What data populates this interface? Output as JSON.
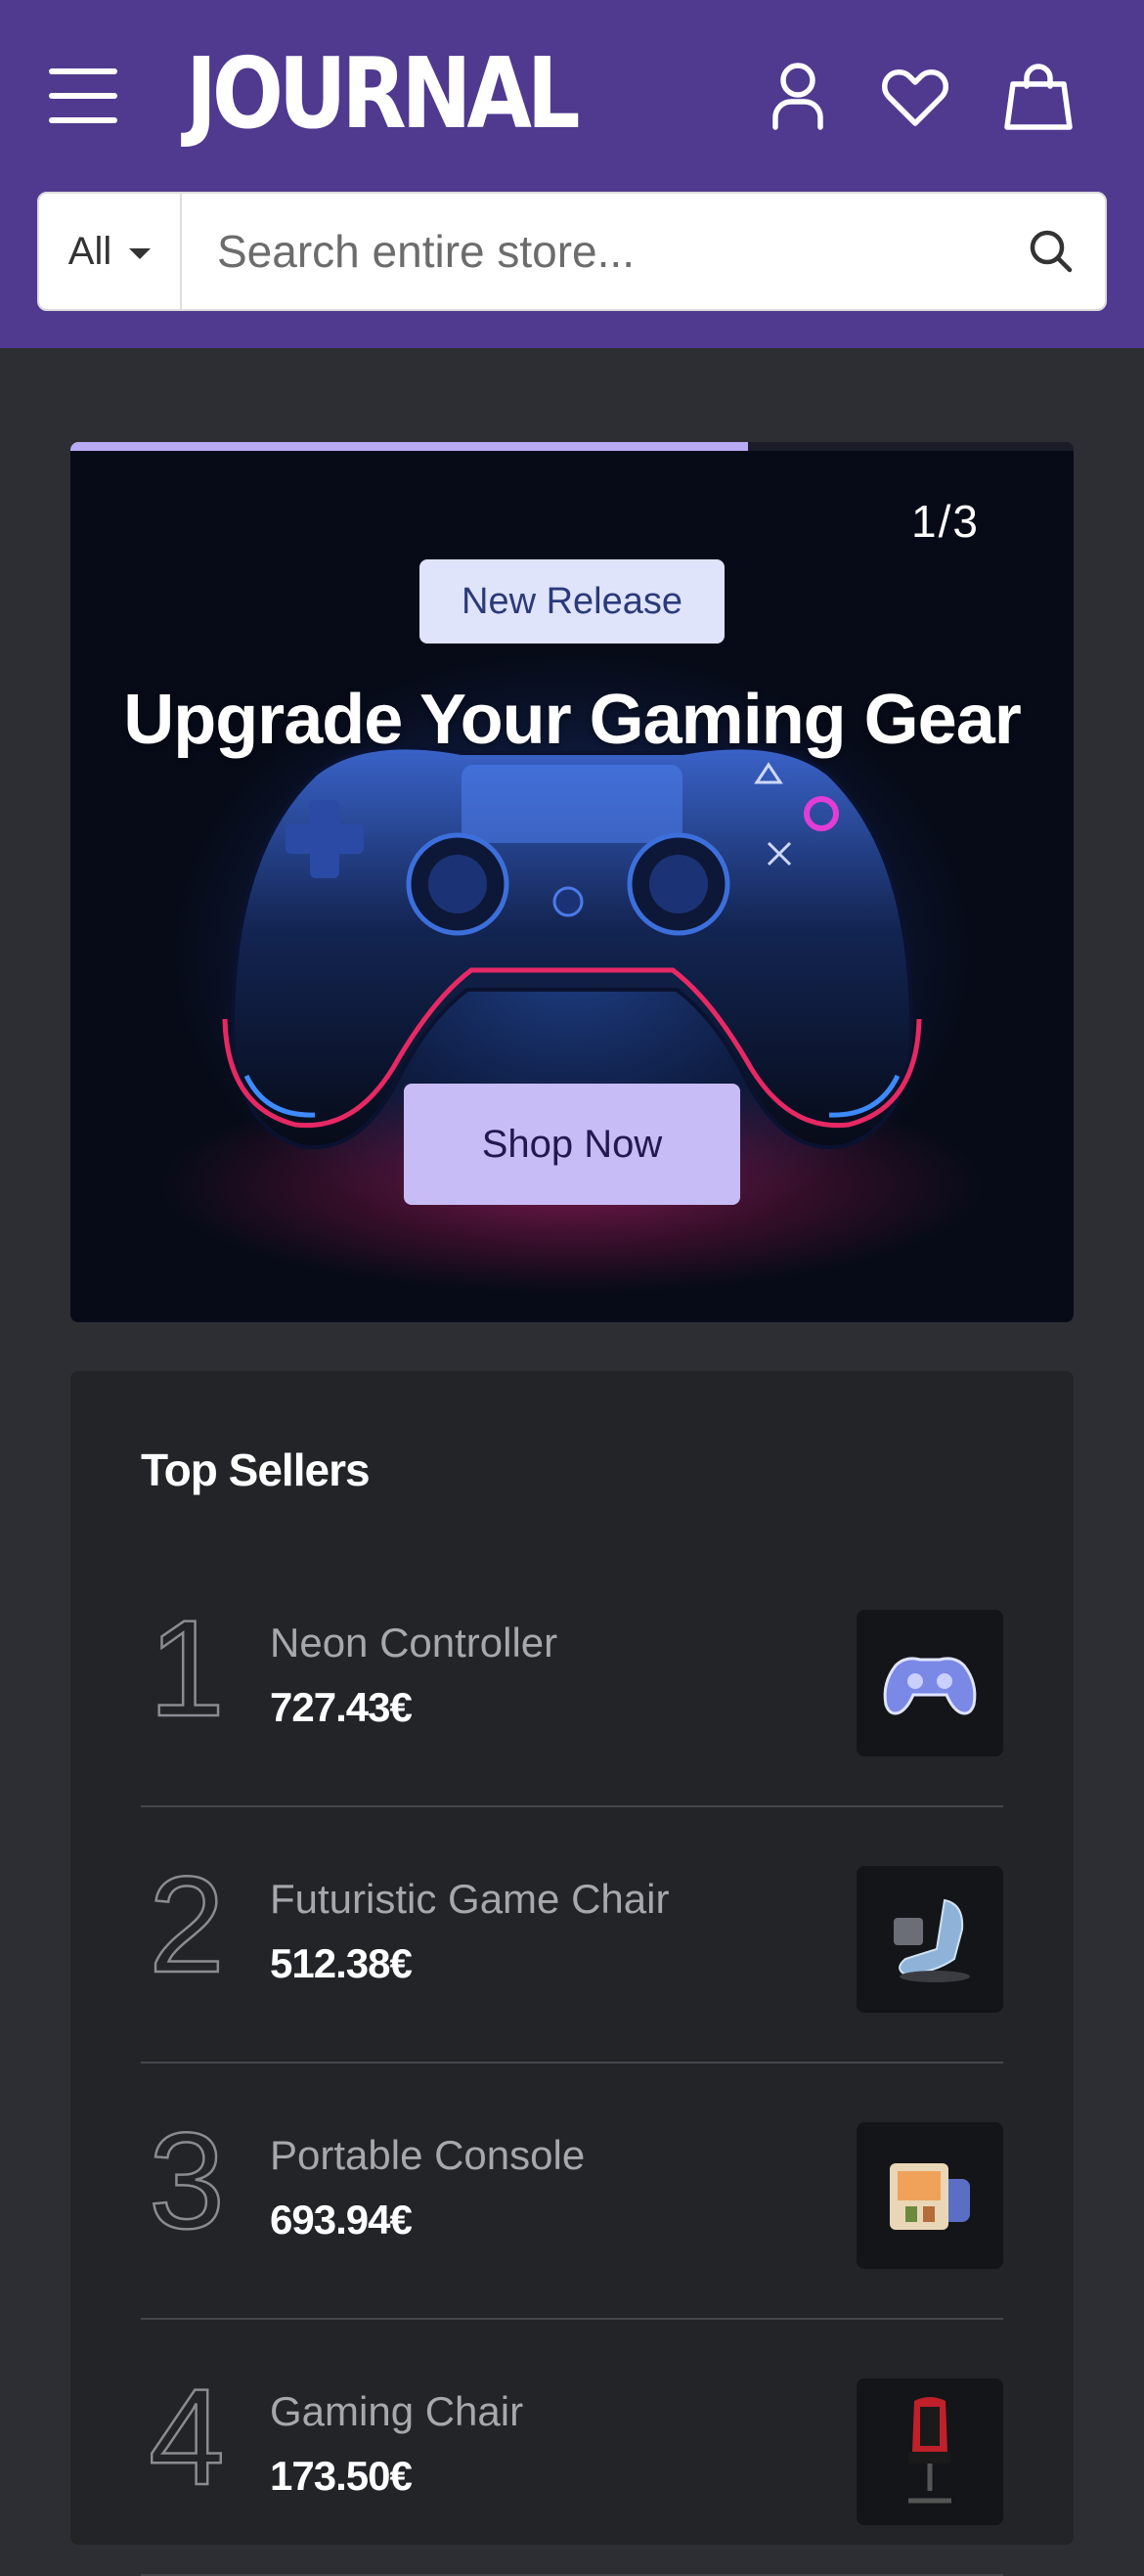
{
  "header": {
    "logo_text": "JOURNAL",
    "colors": {
      "background": "#4f3a8f",
      "icon": "#ffffff"
    },
    "icons": [
      "menu-icon",
      "account-icon",
      "wishlist-heart-icon",
      "cart-bag-icon"
    ]
  },
  "search": {
    "category_label": "All",
    "placeholder": "Search entire store...",
    "value": ""
  },
  "hero": {
    "counter": "1/3",
    "slide_progress": 0.675,
    "badge": "New Release",
    "title": "Upgrade Your Gaming Gear",
    "button": "Shop Now",
    "colors": {
      "badge_bg": "#dfe4fb",
      "button_bg": "#c8bcf7",
      "progress": "#b9aaf5"
    }
  },
  "top_sellers": {
    "title": "Top Sellers",
    "items": [
      {
        "rank": "1",
        "name": "Neon Controller",
        "price": "727.43€",
        "thumb_icon": "game-controller-icon"
      },
      {
        "rank": "2",
        "name": "Futuristic Game Chair",
        "price": "512.38€",
        "thumb_icon": "game-chair-icon"
      },
      {
        "rank": "3",
        "name": "Portable Console",
        "price": "693.94€",
        "thumb_icon": "portable-console-icon"
      },
      {
        "rank": "4",
        "name": "Gaming Chair",
        "price": "173.50€",
        "thumb_icon": "gaming-chair-icon"
      }
    ]
  }
}
